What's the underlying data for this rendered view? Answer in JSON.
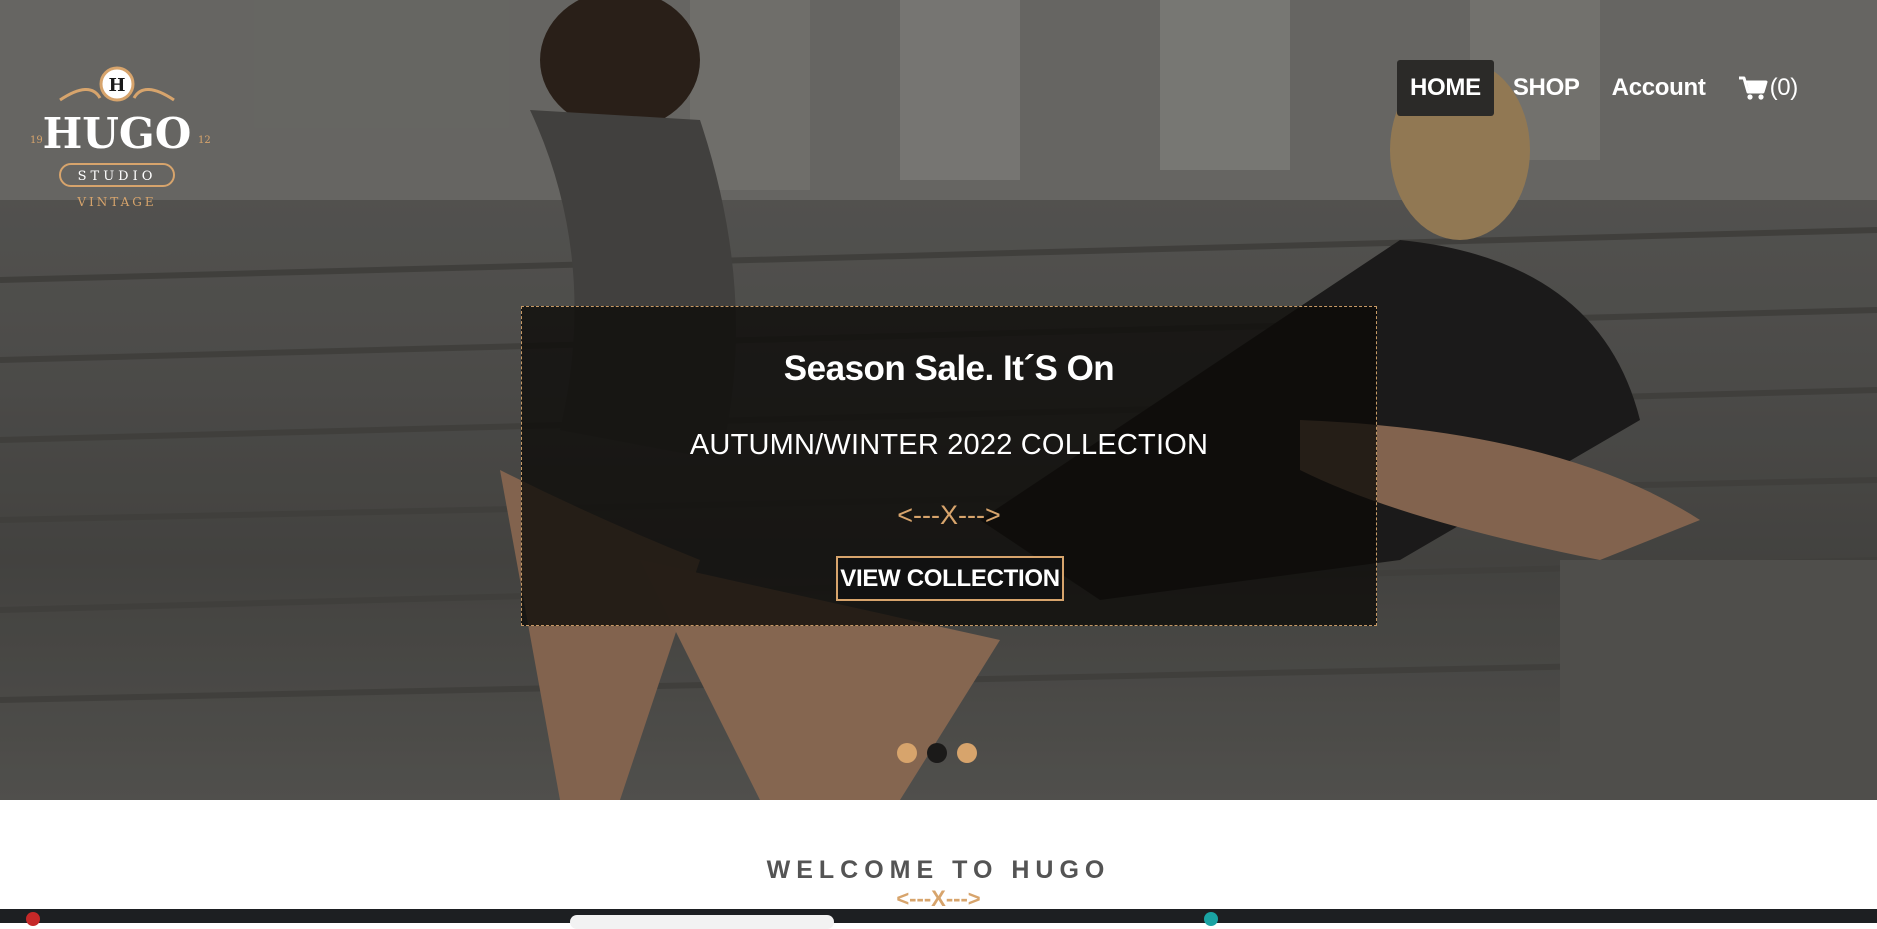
{
  "brand": {
    "initial": "H",
    "name": "HUGO",
    "sub": "STUDIO",
    "tag": "VINTAGE",
    "year_left": "19",
    "year_right": "12"
  },
  "nav": {
    "items": [
      {
        "label": "HOME",
        "active": true
      },
      {
        "label": "SHOP",
        "active": false
      },
      {
        "label": "Account",
        "active": false
      }
    ],
    "cart_count": "(0)"
  },
  "promo": {
    "title": "Season Sale. It´S On",
    "subtitle": "AUTUMN/WINTER 2022 COLLECTION",
    "divider": "<---X--->",
    "button": "VIEW COLLECTION"
  },
  "carousel": {
    "dots": 3,
    "active_index": 1
  },
  "welcome": {
    "title": "WELCOME TO HUGO",
    "divider": "<---X--->"
  },
  "colors": {
    "accent": "#d7a46c",
    "overlay": "#0c0a08",
    "text_dark": "#545454"
  }
}
